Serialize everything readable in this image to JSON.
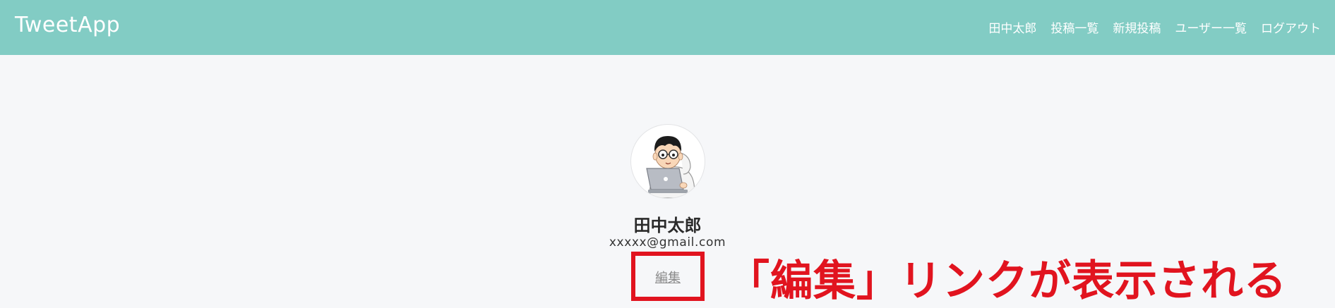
{
  "header": {
    "brand": "TweetApp",
    "nav": [
      {
        "label": "田中太郎"
      },
      {
        "label": "投稿一覧"
      },
      {
        "label": "新規投稿"
      },
      {
        "label": "ユーザー一覧"
      },
      {
        "label": "ログアウト"
      }
    ],
    "background_color": "#82ccc4"
  },
  "profile": {
    "avatar_icon": "user-with-laptop-illustration",
    "name": "田中太郎",
    "email": "xxxxx@gmail.com",
    "edit_label": "編集"
  },
  "annotation": {
    "text": "「編集」リンクが表示される",
    "color": "#e1141f"
  }
}
